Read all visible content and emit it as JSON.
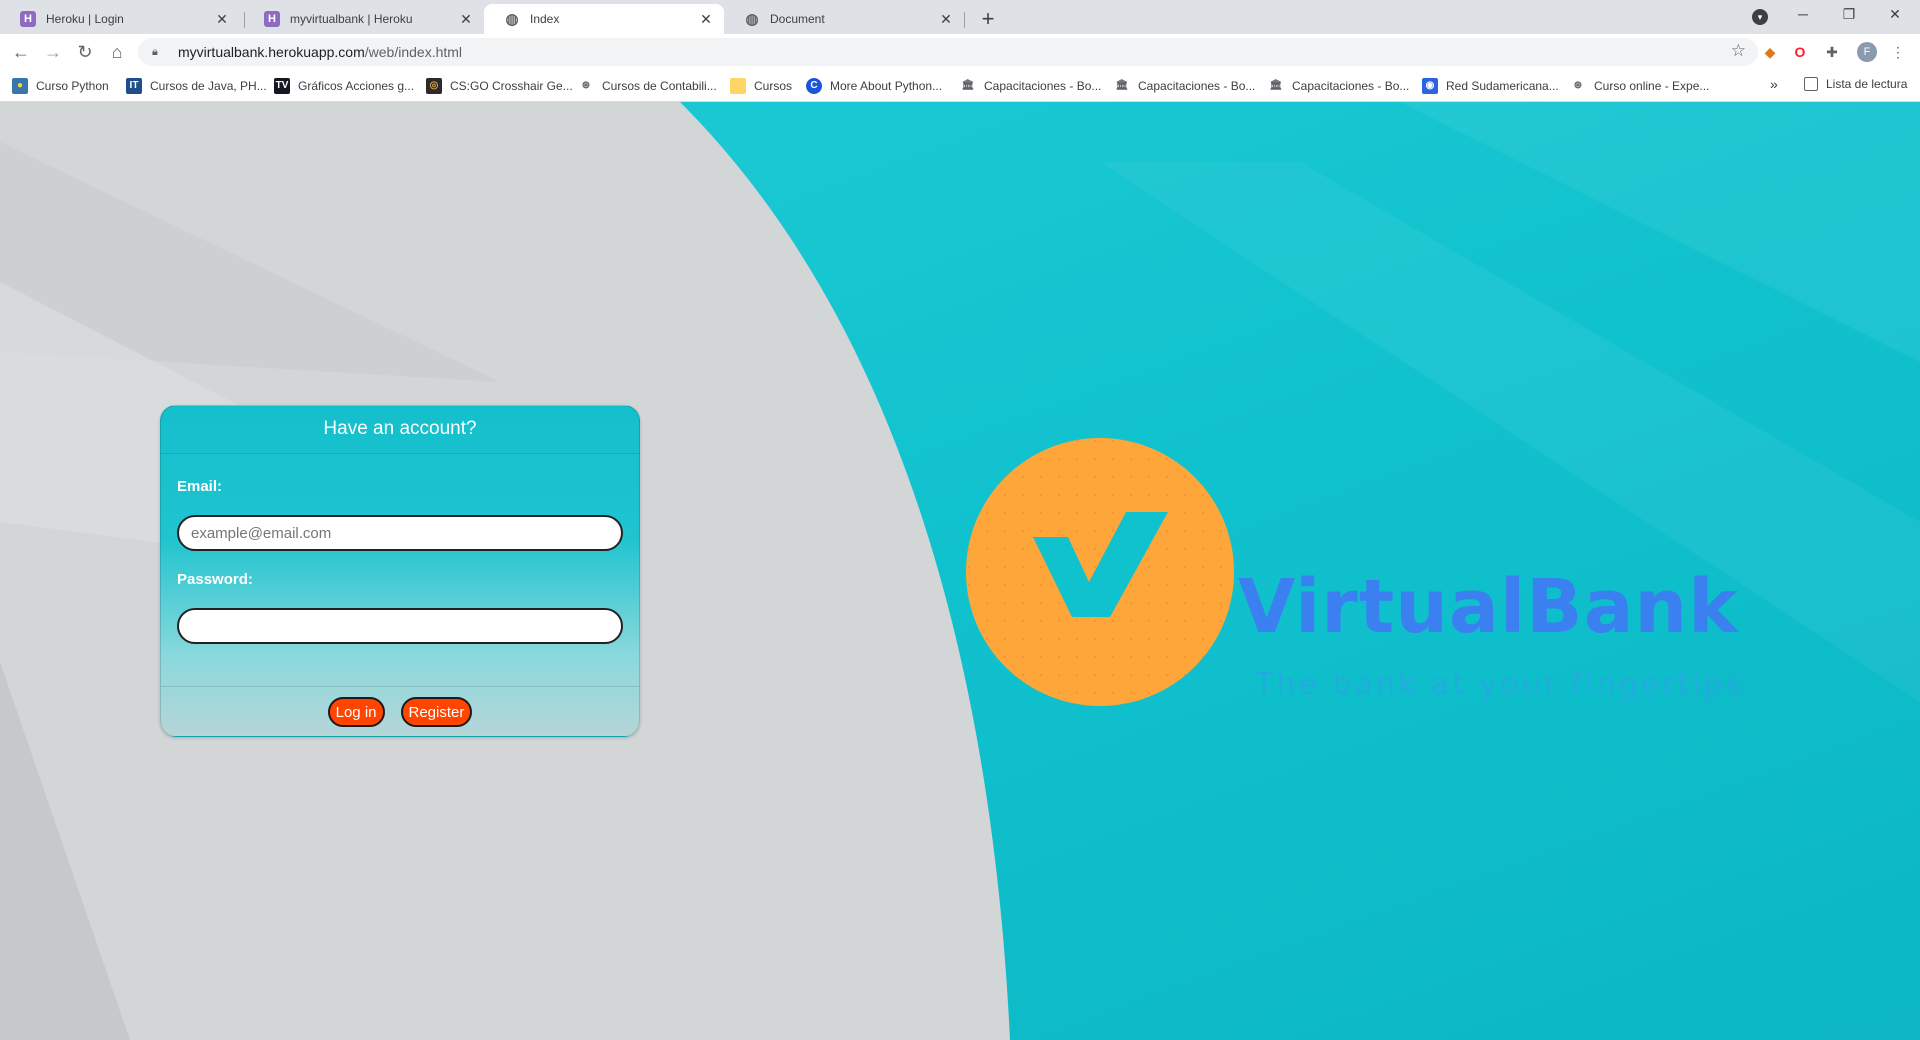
{
  "browser": {
    "tabs": [
      {
        "title": "Heroku | Login",
        "icon": "heroku-icon"
      },
      {
        "title": "myvirtualbank | Heroku",
        "icon": "heroku-icon"
      },
      {
        "title": "Index",
        "icon": "globe-icon"
      },
      {
        "title": "Document",
        "icon": "globe-icon"
      }
    ],
    "url_host": "myvirtualbank.herokuapp.com",
    "url_path": "/web/index.html",
    "profile_initial": "F",
    "bookmarks": [
      {
        "label": "Curso Python"
      },
      {
        "label": "Cursos de Java, PH..."
      },
      {
        "label": "Gráficos Acciones g..."
      },
      {
        "label": "CS:GO Crosshair Ge..."
      },
      {
        "label": "Cursos de Contabili..."
      },
      {
        "label": "Cursos"
      },
      {
        "label": "More About Python..."
      },
      {
        "label": "Capacitaciones - Bo..."
      },
      {
        "label": "Capacitaciones - Bo..."
      },
      {
        "label": "Capacitaciones - Bo..."
      },
      {
        "label": "Red Sudamericana..."
      },
      {
        "label": "Curso online - Expe..."
      }
    ],
    "bookmarks_overflow": "»",
    "reading_list": "Lista de lectura"
  },
  "login": {
    "title": "Have an account?",
    "email_label": "Email:",
    "email_placeholder": "example@email.com",
    "password_label": "Password:",
    "login_button": "Log in",
    "register_button": "Register"
  },
  "brand": {
    "name": "VirtualBank",
    "tagline": "The bank at your fingertips",
    "logo_letter": "V",
    "colors": {
      "teal": "#10c2ce",
      "gray": "#d2d6d7",
      "orange": "#ffa63a",
      "blue": "#3a80f0",
      "button": "#ff4500"
    }
  }
}
